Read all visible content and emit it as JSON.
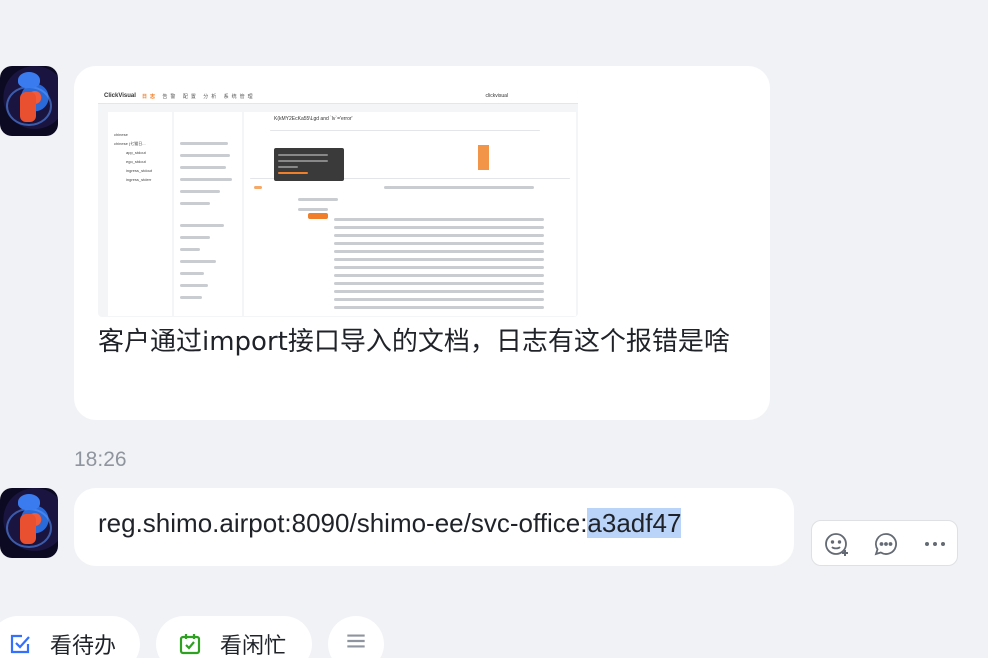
{
  "messages": [
    {
      "type": "image-with-text",
      "screenshot": {
        "logo": "ClickVisual",
        "menu": [
          "日志",
          "告警",
          "配置",
          "分析",
          "系统管理"
        ],
        "brand": "clickvisual",
        "sidebar_items": [
          "chinese",
          "chinese (七猫日...",
          "app_stdout",
          "ego_stdout",
          "ingress_stdout",
          "ingress_stderr"
        ],
        "query": "K(kMY2EcKa55\\Lgd and `lv`='error'"
      },
      "text": "客户通过import接口导入的文档，日志有这个报错是啥"
    },
    {
      "type": "link",
      "time": "18:26",
      "text_before": "reg.shimo.airpot:8090/shimo-ee/svc-office:",
      "text_selected": "a3adf47"
    }
  ],
  "actions": {
    "emoji_icon": "emoji-add-icon",
    "reply_icon": "comment-icon",
    "more_icon": "more-icon"
  },
  "quick_actions": [
    {
      "label": "看待办",
      "icon": "todo-check-icon",
      "color": "#3370ff"
    },
    {
      "label": "看闲忙",
      "icon": "calendar-check-icon",
      "color": "#2ea121"
    }
  ],
  "colors": {
    "background": "#f1f2f5",
    "bubble": "#ffffff",
    "selection": "#b9d4f8",
    "accent_orange": "#f07e2a"
  }
}
